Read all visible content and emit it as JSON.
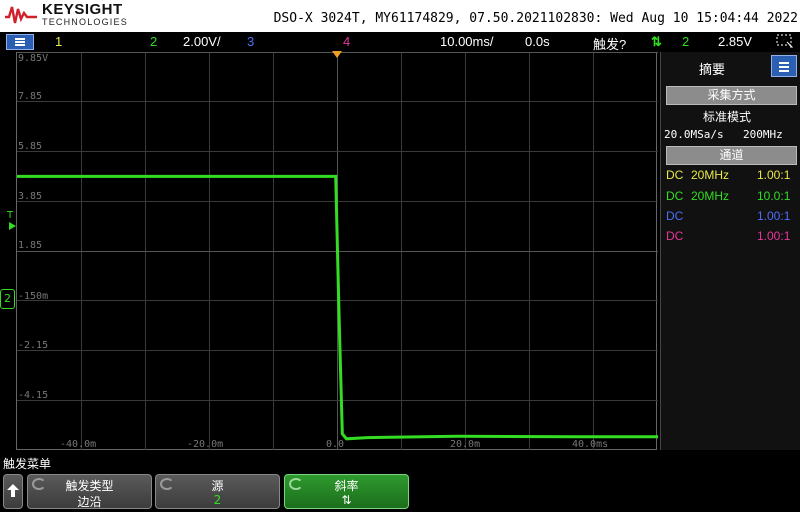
{
  "header": {
    "brand": "KEYSIGHT",
    "brand_sub": "TECHNOLOGIES",
    "scope_info": "DSO-X 3024T, MY61174829, 07.50.2021102830: Wed Aug 10 15:04:44 2022"
  },
  "status": {
    "ch1_num": "1",
    "ch2_num": "2",
    "ch2_scale": "2.00V/",
    "ch3_num": "3",
    "ch4_num": "4",
    "timebase": "10.00ms/",
    "delay": "0.0s",
    "trig_label": "触发?",
    "trig_slope": "⇅",
    "trig_src": "2",
    "trig_level": "2.85V"
  },
  "plot": {
    "y_labels": [
      "9.85V",
      "7.85",
      "5.85",
      "3.85",
      "1.85",
      "-150m",
      "-2.15",
      "-4.15"
    ],
    "x_labels": [
      "-40.0m",
      "-20.0m",
      "0.0",
      "20.0m",
      "40.0ms"
    ],
    "trigger_marker": "T",
    "ch2_marker": "2"
  },
  "chart_data": {
    "type": "line",
    "series": [
      {
        "name": "2",
        "color": "#33dd22",
        "x": [
          -53.5,
          -0.3,
          -0.3,
          0.2,
          0.4,
          0.8,
          1.5,
          5,
          20,
          40,
          53.5
        ],
        "y": [
          4.85,
          4.85,
          4.85,
          -0.15,
          -2.0,
          -5.5,
          -5.7,
          -5.65,
          -5.6,
          -5.62,
          -5.62
        ]
      }
    ],
    "xlim": [
      -53.5,
      53.5
    ],
    "ylim": [
      -6.15,
      9.85
    ],
    "grid": true
  },
  "side": {
    "title": "摘要",
    "acq_button": "采集方式",
    "acq_mode": "标准模式",
    "sample_rate": "20.0MSa/s",
    "bandwidth": "200MHz",
    "channel_button": "通道",
    "channels": [
      {
        "coupling": "DC",
        "bw": "20MHz",
        "probe": "1.00:1",
        "color": "#e8e84a"
      },
      {
        "coupling": "DC",
        "bw": "20MHz",
        "probe": "10.0:1",
        "color": "#33dd22"
      },
      {
        "coupling": "DC",
        "bw": "",
        "probe": "1.00:1",
        "color": "#4f6df5"
      },
      {
        "coupling": "DC",
        "bw": "",
        "probe": "1.00:1",
        "color": "#e8359a"
      }
    ]
  },
  "softkeys": {
    "menu_label": "触发菜单",
    "type_title": "触发类型",
    "type_value": "边沿",
    "source_title": "源",
    "source_value": "2",
    "slope_title": "斜率",
    "slope_value": "⇅"
  },
  "colors": {
    "ch1": "#e8e84a",
    "ch2": "#33dd22",
    "ch3": "#4f6df5",
    "ch4": "#e8359a",
    "trigger_marker": "#f0a020",
    "active_softkey": "#2a8a2a"
  }
}
